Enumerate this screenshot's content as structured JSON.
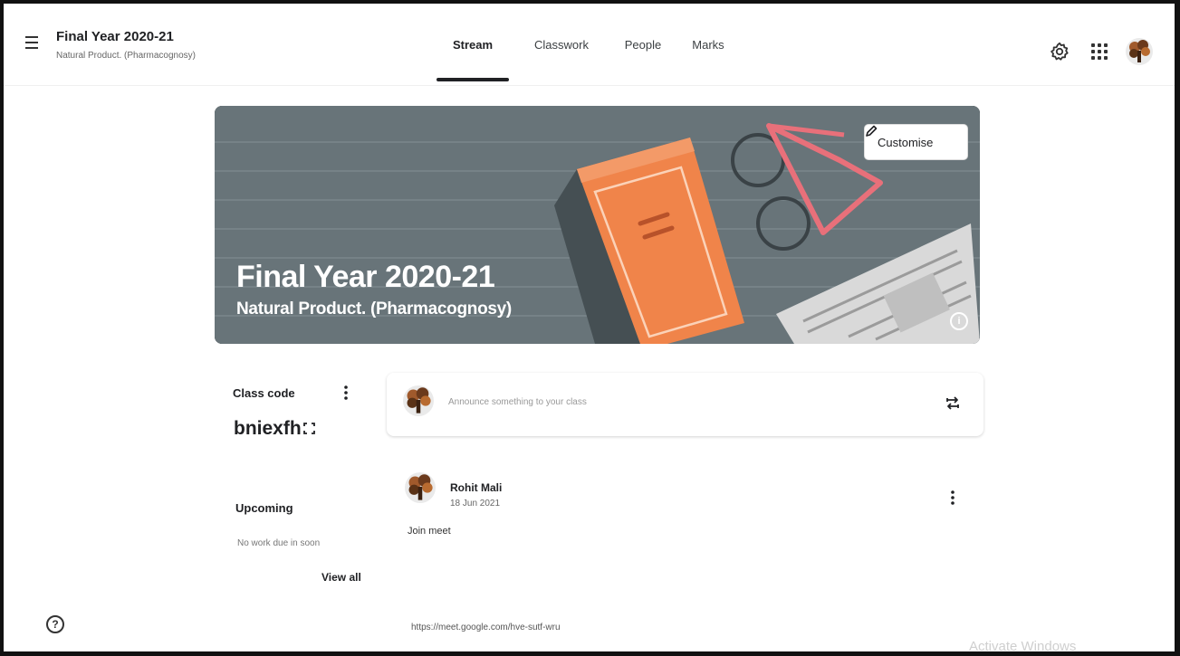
{
  "header": {
    "class_title": "Final Year 2020-21",
    "class_subtitle": "Natural Product. (Pharmacognosy)",
    "tabs": [
      {
        "label": "Stream",
        "active": true
      },
      {
        "label": "Classwork",
        "active": false
      },
      {
        "label": "People",
        "active": false
      },
      {
        "label": "Marks",
        "active": false
      }
    ],
    "icons": [
      "menu-icon",
      "gear-icon",
      "apps-grid-icon",
      "profile-avatar"
    ]
  },
  "banner": {
    "title": "Final Year 2020-21",
    "subtitle": "Natural Product. (Pharmacognosy)",
    "customise_label": "Customise",
    "info_glyph": "i",
    "colors": {
      "background": "#687479",
      "book": "#f0844a",
      "glasses": "#e8707a"
    }
  },
  "sidebar": {
    "class_code_label": "Class code",
    "class_code_value": "bniexfh",
    "upcoming_label": "Upcoming",
    "upcoming_empty": "No work due in soon",
    "view_all_label": "View all"
  },
  "announce": {
    "placeholder": "Announce something to your class"
  },
  "post": {
    "author": "Rohit Mali",
    "date": "18 Jun 2021",
    "text": "Join meet",
    "link": "https://meet.google.com/hve-sutf-wru"
  },
  "help_glyph": "?",
  "watermark": "Activate Windows"
}
